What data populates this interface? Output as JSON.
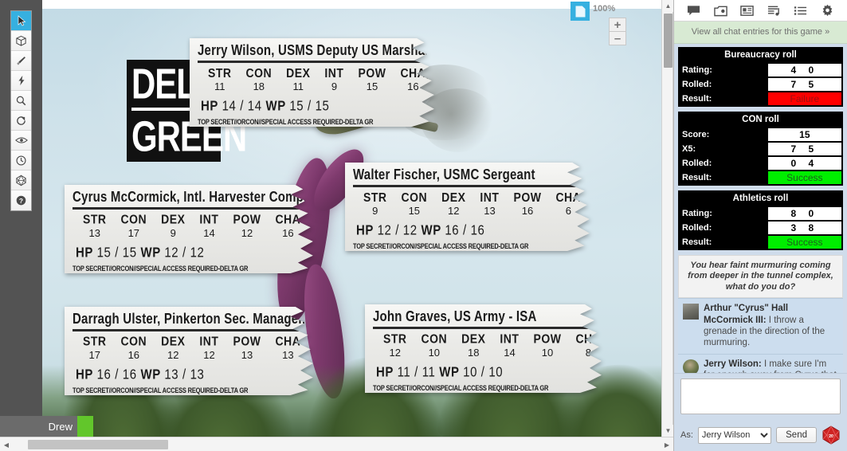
{
  "toolbar": {
    "tools": [
      {
        "name": "select-tool",
        "icon": "cursor-arrow-icon",
        "active": true
      },
      {
        "name": "shape-tool",
        "icon": "cube-icon",
        "active": false
      },
      {
        "name": "draw-tool",
        "icon": "paintbrush-icon",
        "active": false
      },
      {
        "name": "fx-tool",
        "icon": "lightning-bolt-icon",
        "active": false
      },
      {
        "name": "zoom-tool",
        "icon": "magnifier-icon",
        "active": false
      },
      {
        "name": "rotate-tool",
        "icon": "rotate-icon",
        "active": false
      },
      {
        "name": "visibility-tool",
        "icon": "eye-icon",
        "active": false
      },
      {
        "name": "turn-order-tool",
        "icon": "clock-icon",
        "active": false
      },
      {
        "name": "dice-tool",
        "icon": "d20-dice-icon",
        "active": false
      },
      {
        "name": "help-tool",
        "icon": "question-mark-icon",
        "active": false
      }
    ]
  },
  "map": {
    "logo": {
      "line1": "DELTA",
      "line2": "GREEN"
    },
    "zoom": {
      "level": "100%",
      "zoom_in_label": "+",
      "zoom_out_label": "–",
      "page_icon": "page-icon"
    },
    "player_tab": {
      "name": "Drew",
      "color": "#62c62b"
    },
    "classification": "TOP SECRET//ORCON//SPECIAL ACCESS REQUIRED-DELTA GR",
    "attr_labels": [
      "STR",
      "CON",
      "DEX",
      "INT",
      "POW",
      "CHA"
    ],
    "hp_label": "HP",
    "wp_label": "WP",
    "slash": "/",
    "sheets": [
      {
        "title": "Jerry Wilson, USMS Deputy US Marshall I",
        "attrs": [
          "11",
          "18",
          "11",
          "9",
          "15",
          "16"
        ],
        "hp": "14",
        "hp_max": "14",
        "wp": "15",
        "wp_max": "15"
      },
      {
        "title": "Walter Fischer, USMC Sergeant",
        "attrs": [
          "9",
          "15",
          "12",
          "13",
          "16",
          "6"
        ],
        "hp": "12",
        "hp_max": "12",
        "wp": "16",
        "wp_max": "16"
      },
      {
        "title": "Cyrus McCormick, Intl. Harvester Company",
        "attrs": [
          "13",
          "17",
          "9",
          "14",
          "12",
          "16"
        ],
        "hp": "15",
        "hp_max": "15",
        "wp": "12",
        "wp_max": "12"
      },
      {
        "title": "Darragh Ulster, Pinkerton Sec. Management",
        "attrs": [
          "17",
          "16",
          "12",
          "12",
          "13",
          "13"
        ],
        "hp": "16",
        "hp_max": "16",
        "wp": "13",
        "wp_max": "13"
      },
      {
        "title": "John Graves, US Army - ISA",
        "attrs": [
          "12",
          "10",
          "18",
          "14",
          "10",
          "8"
        ],
        "hp": "11",
        "hp_max": "11",
        "wp": "10",
        "wp_max": "10"
      }
    ]
  },
  "sidebar": {
    "icons": [
      {
        "name": "chat-icon"
      },
      {
        "name": "art-library-icon"
      },
      {
        "name": "journal-icon"
      },
      {
        "name": "compendium-icon"
      },
      {
        "name": "turn-order-list-icon"
      },
      {
        "name": "settings-gear-icon"
      }
    ],
    "view_all_link": "View all chat entries for this game »",
    "rolls": [
      {
        "title": "Bureaucracy roll",
        "rows": [
          {
            "label": "Rating:",
            "value": "4   0",
            "style": "plain"
          },
          {
            "label": "Rolled:",
            "value": "7   5",
            "style": "plain"
          },
          {
            "label": "Result:",
            "value": "Failure",
            "style": "fail"
          }
        ]
      },
      {
        "title": "CON roll",
        "rows": [
          {
            "label": "Score:",
            "value": "15",
            "style": "single"
          },
          {
            "label": "X5:",
            "value": "7   5",
            "style": "plain"
          },
          {
            "label": "Rolled:",
            "value": "0   4",
            "style": "plain"
          },
          {
            "label": "Result:",
            "value": "Success",
            "style": "succ"
          }
        ]
      },
      {
        "title": "Athletics roll",
        "rows": [
          {
            "label": "Rating:",
            "value": "8   0",
            "style": "plain"
          },
          {
            "label": "Rolled:",
            "value": "3   8",
            "style": "plain"
          },
          {
            "label": "Result:",
            "value": "Success",
            "style": "succ"
          }
        ]
      }
    ],
    "gm_narration": "You hear faint murmuring coming from deeper in the tunnel complex, what do you do?",
    "messages": [
      {
        "speaker": "Arthur \"Cyrus\" Hall McCormick III:",
        "text": " I throw a grenade in the direction of the murmuring.",
        "avatar": "avatar-cyrus"
      },
      {
        "speaker": "Jerry Wilson:",
        "text": " I make sure I'm far enough away from Cyrus that on a fumble I don't get blown up.",
        "avatar": "avatar-jerry"
      }
    ],
    "composer": {
      "message_value": "",
      "message_placeholder": "",
      "as_label": "As:",
      "as_selected": "Jerry Wilson",
      "as_options": [
        "Jerry Wilson"
      ],
      "send_label": "Send",
      "dice_icon": "d20-dice-icon"
    }
  },
  "colors": {
    "accent": "#36b0e0",
    "success": "#00ee00",
    "failure": "#ff0000",
    "player": "#62c62b",
    "banner": "#d8ead3",
    "sidebar_bg": "#cfdceb"
  }
}
